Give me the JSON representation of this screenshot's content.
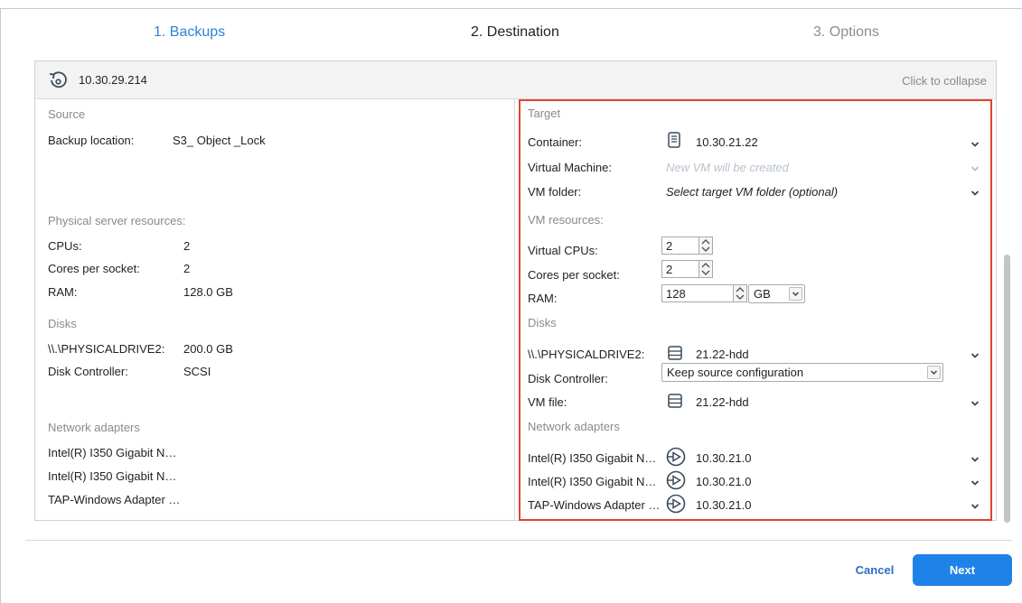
{
  "steps": {
    "step1": "1. Backups",
    "step2": "2. Destination",
    "step3": "3. Options"
  },
  "panel": {
    "title": "10.30.29.214",
    "collapse": "Click to collapse"
  },
  "source": {
    "heading": "Source",
    "backup_location_label": "Backup location:",
    "backup_location_value": "S3_ Object _Lock",
    "resources_heading": "Physical server resources:",
    "cpus_label": "CPUs:",
    "cpus_value": "2",
    "cores_label": "Cores per socket:",
    "cores_value": "2",
    "ram_label": "RAM:",
    "ram_value": "128.0 GB",
    "disks_heading": "Disks",
    "drive_label": "\\\\.\\PHYSICALDRIVE2:",
    "drive_value": "200.0 GB",
    "controller_label": "Disk Controller:",
    "controller_value": "SCSI",
    "network_heading": "Network adapters",
    "adapters": [
      "Intel(R) I350 Gigabit N…",
      "Intel(R) I350 Gigabit N…",
      "TAP-Windows Adapter …"
    ]
  },
  "target": {
    "heading": "Target",
    "container_label": "Container:",
    "container_value": "10.30.21.22",
    "vm_label": "Virtual Machine:",
    "vm_placeholder": "New VM will be created",
    "folder_label": "VM folder:",
    "folder_value": "Select target VM folder (optional)",
    "resources_heading": "VM resources:",
    "vcpus_label": "Virtual CPUs:",
    "vcpus_value": "2",
    "cores_label": "Cores per socket:",
    "cores_value": "2",
    "ram_label": "RAM:",
    "ram_value": "128",
    "ram_unit": "GB",
    "disks_heading": "Disks",
    "drive_label": "\\\\.\\PHYSICALDRIVE2:",
    "drive_value": "21.22-hdd",
    "controller_label": "Disk Controller:",
    "controller_value": "Keep source configuration",
    "vmfile_label": "VM file:",
    "vmfile_value": "21.22-hdd",
    "network_heading": "Network adapters",
    "adapters": [
      {
        "label": "Intel(R) I350 Gigabit N…",
        "value": "10.30.21.0"
      },
      {
        "label": "Intel(R) I350 Gigabit N…",
        "value": "10.30.21.0"
      },
      {
        "label": "TAP-Windows Adapter …",
        "value": "10.30.21.0"
      }
    ]
  },
  "footer": {
    "cancel": "Cancel",
    "next": "Next"
  },
  "colors": {
    "accent": "#1e83e8",
    "active_step": "#2f83d6",
    "highlight_border": "#e0442e"
  },
  "icons": [
    "restore-icon",
    "server-icon",
    "storage-icon",
    "network-icon",
    "chevron-down-icon"
  ]
}
